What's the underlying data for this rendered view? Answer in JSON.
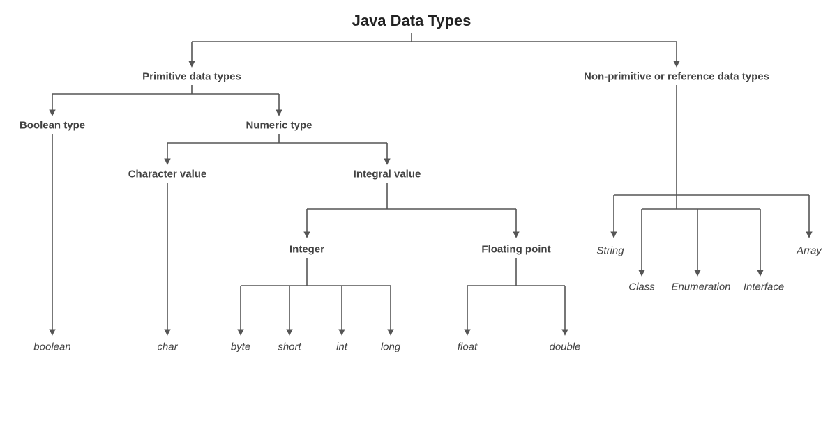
{
  "diagram": {
    "title": "Java Data Types",
    "primitive_label": "Primitive data types",
    "nonprimitive_label": "Non-primitive or reference data types",
    "boolean_type_label": "Boolean type",
    "numeric_type_label": "Numeric type",
    "character_value_label": "Character value",
    "integral_value_label": "Integral value",
    "integer_label": "Integer",
    "floating_point_label": "Floating point",
    "leaves": {
      "boolean": "boolean",
      "char": "char",
      "byte": "byte",
      "short": "short",
      "int": "int",
      "long": "long",
      "float": "float",
      "double": "double",
      "string": "String",
      "class": "Class",
      "enumeration": "Enumeration",
      "interface": "Interface",
      "array": "Array"
    }
  }
}
